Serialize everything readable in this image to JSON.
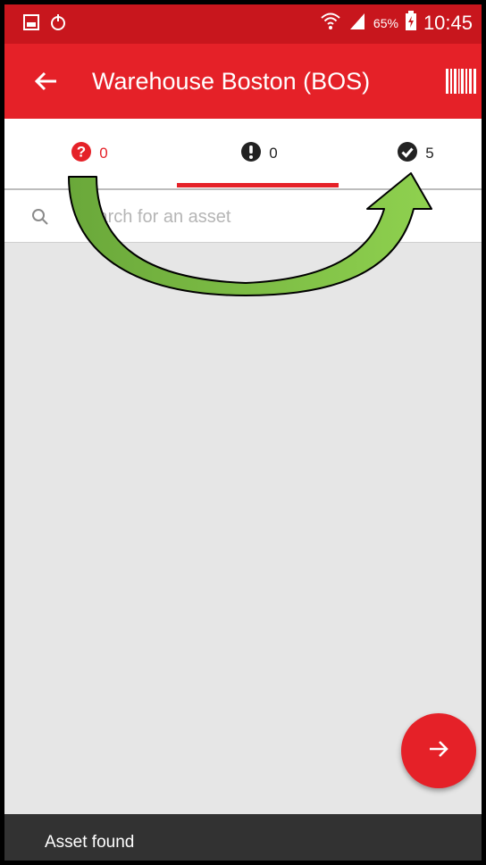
{
  "status_bar": {
    "battery_percent": "65%",
    "time": "10:45",
    "icons": [
      "gallery-icon",
      "sync-icon",
      "wifi-icon",
      "signal-icon",
      "battery-icon"
    ]
  },
  "app_bar": {
    "title": "Warehouse Boston (BOS)",
    "icons": [
      "back-arrow-icon",
      "barcode-icon"
    ]
  },
  "tabs": [
    {
      "name": "unknown",
      "icon": "question-circle-icon",
      "count": "0",
      "color": "#e52128"
    },
    {
      "name": "alert",
      "icon": "exclamation-circle-icon",
      "count": "0",
      "color": "#222222",
      "selected": true
    },
    {
      "name": "found",
      "icon": "check-circle-icon",
      "count": "5",
      "color": "#222222"
    }
  ],
  "search": {
    "placeholder": "Search for an asset",
    "value": ""
  },
  "fab": {
    "icon": "arrow-right-icon"
  },
  "snackbar": {
    "text": "Asset found"
  },
  "colors": {
    "status_bar": "#c8161d",
    "primary": "#e52128",
    "background": "#e6e6e6",
    "snackbar": "#323232",
    "annotation_arrow": "#7cc242"
  }
}
